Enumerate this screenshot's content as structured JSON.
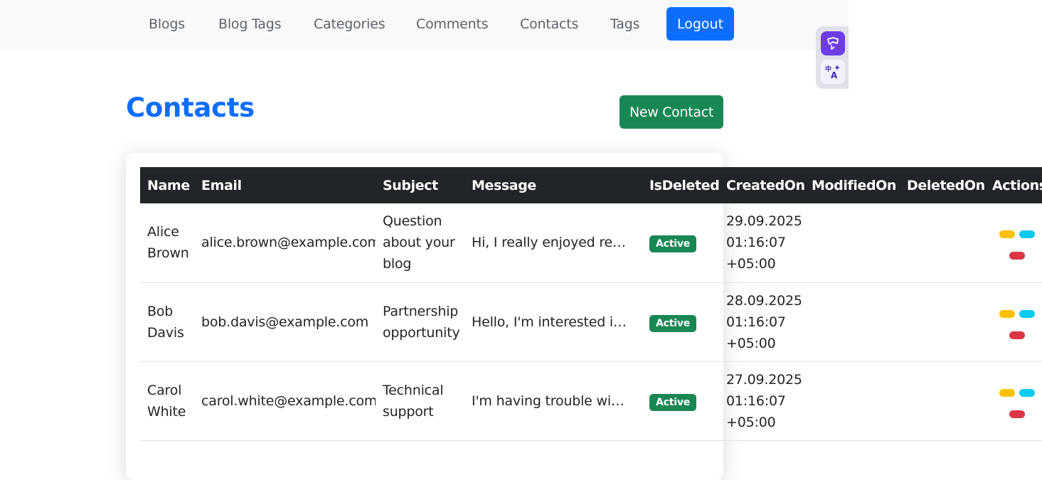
{
  "nav": {
    "links": [
      "Blogs",
      "Blog Tags",
      "Categories",
      "Comments",
      "Contacts",
      "Tags"
    ],
    "logout_label": "Logout"
  },
  "page": {
    "title": "Contacts",
    "new_button_label": "New Contact"
  },
  "table": {
    "headers": [
      "Name",
      "Email",
      "Subject",
      "Message",
      "IsDeleted",
      "CreatedOn",
      "ModifiedOn",
      "DeletedOn",
      "Actions"
    ],
    "rows": [
      {
        "name": "Alice Brown",
        "email": "alice.brown@example.com",
        "subject": "Question about your blog",
        "message": "Hi, I really enjoyed readi...",
        "status": "Active",
        "created": "29.09.2025 01:16:07 +05:00",
        "modified": "",
        "deleted": ""
      },
      {
        "name": "Bob Davis",
        "email": "bob.davis@example.com",
        "subject": "Partnership opportunity",
        "message": "Hello, I'm interested in c...",
        "status": "Active",
        "created": "28.09.2025 01:16:07 +05:00",
        "modified": "",
        "deleted": ""
      },
      {
        "name": "Carol White",
        "email": "carol.white@example.com",
        "subject": "Technical support",
        "message": "I'm having trouble with ...",
        "status": "Active",
        "created": "27.09.2025 01:16:07 +05:00",
        "modified": "",
        "deleted": ""
      }
    ]
  },
  "colors": {
    "primary": "#0d6efd",
    "success": "#198754",
    "warning": "#ffc107",
    "info": "#0dcaf0",
    "danger": "#dc3545",
    "dark": "#212529"
  },
  "extension": {
    "icons": [
      "screenshot-icon",
      "translate-icon"
    ]
  }
}
